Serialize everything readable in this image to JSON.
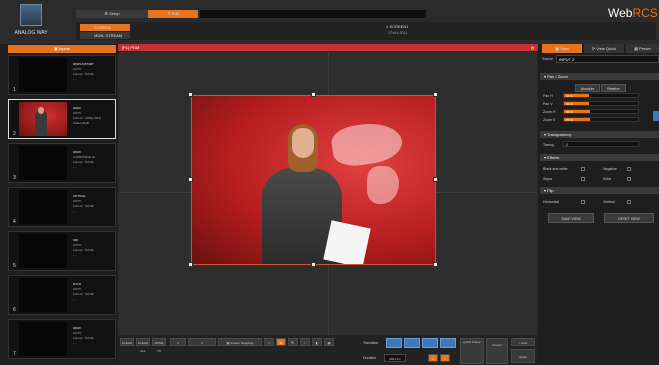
{
  "header": {
    "brand": "ANALOG WAY",
    "app_name_prefix": "Web",
    "app_name_suffix": "RCS",
    "tabs": [
      {
        "label": "Setup"
      },
      {
        "label": "Edit"
      }
    ],
    "screen_button": "SCREEN",
    "mon_button": "MON. STREAM",
    "screen_id": "SCREEN1",
    "resolution": "1Tvd x 2021"
  },
  "left": {
    "title": "Inputs",
    "inputs": [
      {
        "num": "1",
        "name": "DISPLAYPORT",
        "line1": "AUTO",
        "line2": "Format : NONE",
        "line3": "- -"
      },
      {
        "num": "2",
        "name": "HDMI",
        "line1": "AUTO",
        "line2": "Format : 1080p 50Hz",
        "line3": "Status:RGB"
      },
      {
        "num": "3",
        "name": "HDMI",
        "line1": "COMPOSITE HI",
        "line2": "Format : NONE",
        "line3": "- -"
      },
      {
        "num": "4",
        "name": "OPTICAL",
        "line1": "AUTO",
        "line2": "Format : NONE",
        "line3": "- -"
      },
      {
        "num": "5",
        "name": "SDI",
        "line1": "AUTO",
        "line2": "Format : NONE",
        "line3": "- -"
      },
      {
        "num": "6",
        "name": "DVI-D",
        "line1": "AUTO",
        "line2": "Format : NONE",
        "line3": "- -"
      },
      {
        "num": "7",
        "name": "HDMI",
        "line1": "AUTO",
        "line2": "Format : NONE",
        "line3": "- -"
      }
    ]
  },
  "center": {
    "preview_title": "[P1] PGM",
    "toolbar": {
      "clear": "CLEAR",
      "clear_all": "CLEAR ALL",
      "move": "MOVE TO",
      "screen_snapping": "Screen Snapping",
      "transition_label": "Transition",
      "duration_label": "Duration",
      "duration_value": "0001.0 s",
      "quick_frame": "Quick Frame",
      "freeze": "Freeze",
      "auto": "Auto",
      "apply": "Apply"
    }
  },
  "right": {
    "tabs": [
      {
        "label": "View"
      },
      {
        "label": "View Quick"
      },
      {
        "label": "Preset"
      }
    ],
    "source_label": "Source",
    "source_value": "INPUT 2",
    "pan_zoom": {
      "title": "Pan / Zoom",
      "mode_a": "Absolute",
      "mode_b": "Relative",
      "rows": [
        {
          "label": "Pan H",
          "value": "34 %",
          "fill": 0.34
        },
        {
          "label": "Pan V",
          "value": "34 %",
          "fill": 0.34
        },
        {
          "label": "Zoom H",
          "value": "35 %",
          "fill": 0.35
        },
        {
          "label": "Zoom V",
          "value": "35 %",
          "fill": 0.35
        }
      ]
    },
    "transparency": {
      "title": "Transparency",
      "label": "Transp.",
      "value": "0"
    },
    "effects": {
      "title": "Effects",
      "items": [
        "Black and white",
        "Negative",
        "Sepia",
        "Solar"
      ]
    },
    "flip": {
      "title": "Flip",
      "items": [
        "Horizontal",
        "Vertical"
      ]
    },
    "buttons": {
      "save": "SAVE VIEW",
      "reset": "RESET VIEW"
    }
  },
  "colors": {
    "accent": "#e6741e",
    "preview_red": "#c83030",
    "selected_blue": "#3a7ab8"
  }
}
